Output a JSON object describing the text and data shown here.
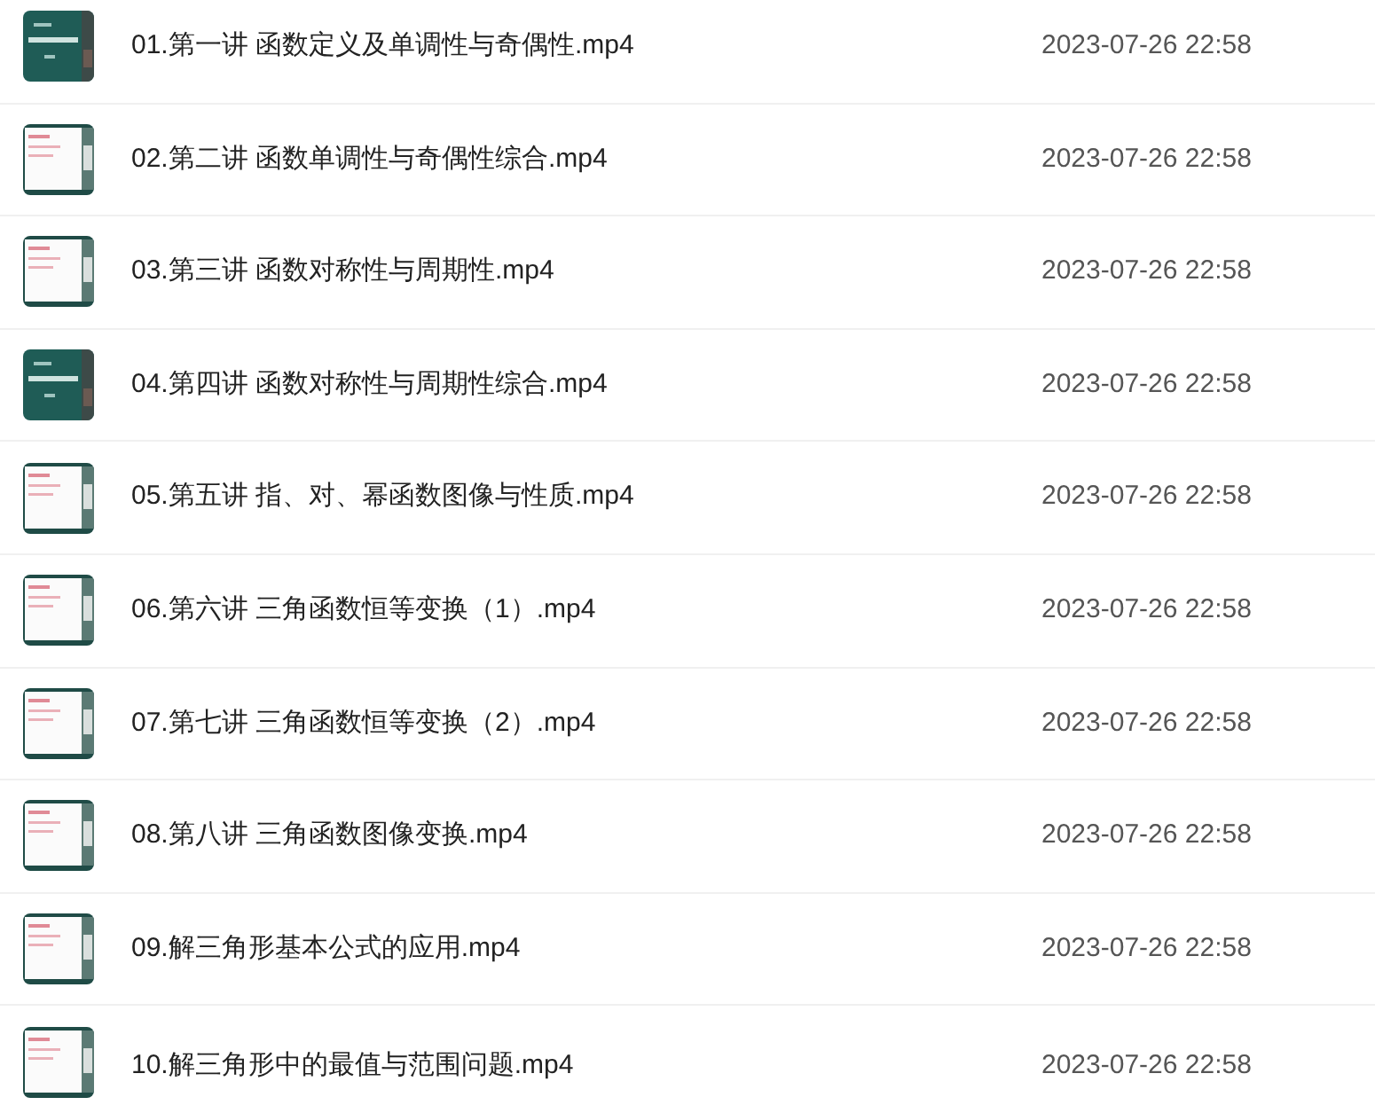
{
  "files": [
    {
      "name": "01.第一讲 函数定义及单调性与奇偶性.mp4",
      "modified": "2023-07-26 22:58"
    },
    {
      "name": "02.第二讲 函数单调性与奇偶性综合.mp4",
      "modified": "2023-07-26 22:58"
    },
    {
      "name": "03.第三讲 函数对称性与周期性.mp4",
      "modified": "2023-07-26 22:58"
    },
    {
      "name": "04.第四讲 函数对称性与周期性综合.mp4",
      "modified": "2023-07-26 22:58"
    },
    {
      "name": "05.第五讲 指、对、幂函数图像与性质.mp4",
      "modified": "2023-07-26 22:58"
    },
    {
      "name": "06.第六讲 三角函数恒等变换（1）.mp4",
      "modified": "2023-07-26 22:58"
    },
    {
      "name": "07.第七讲 三角函数恒等变换（2）.mp4",
      "modified": "2023-07-26 22:58"
    },
    {
      "name": "08.第八讲 三角函数图像变换.mp4",
      "modified": "2023-07-26 22:58"
    },
    {
      "name": "09.解三角形基本公式的应用.mp4",
      "modified": "2023-07-26 22:58"
    },
    {
      "name": "10.解三角形中的最值与范围问题.mp4",
      "modified": "2023-07-26 22:58"
    }
  ]
}
